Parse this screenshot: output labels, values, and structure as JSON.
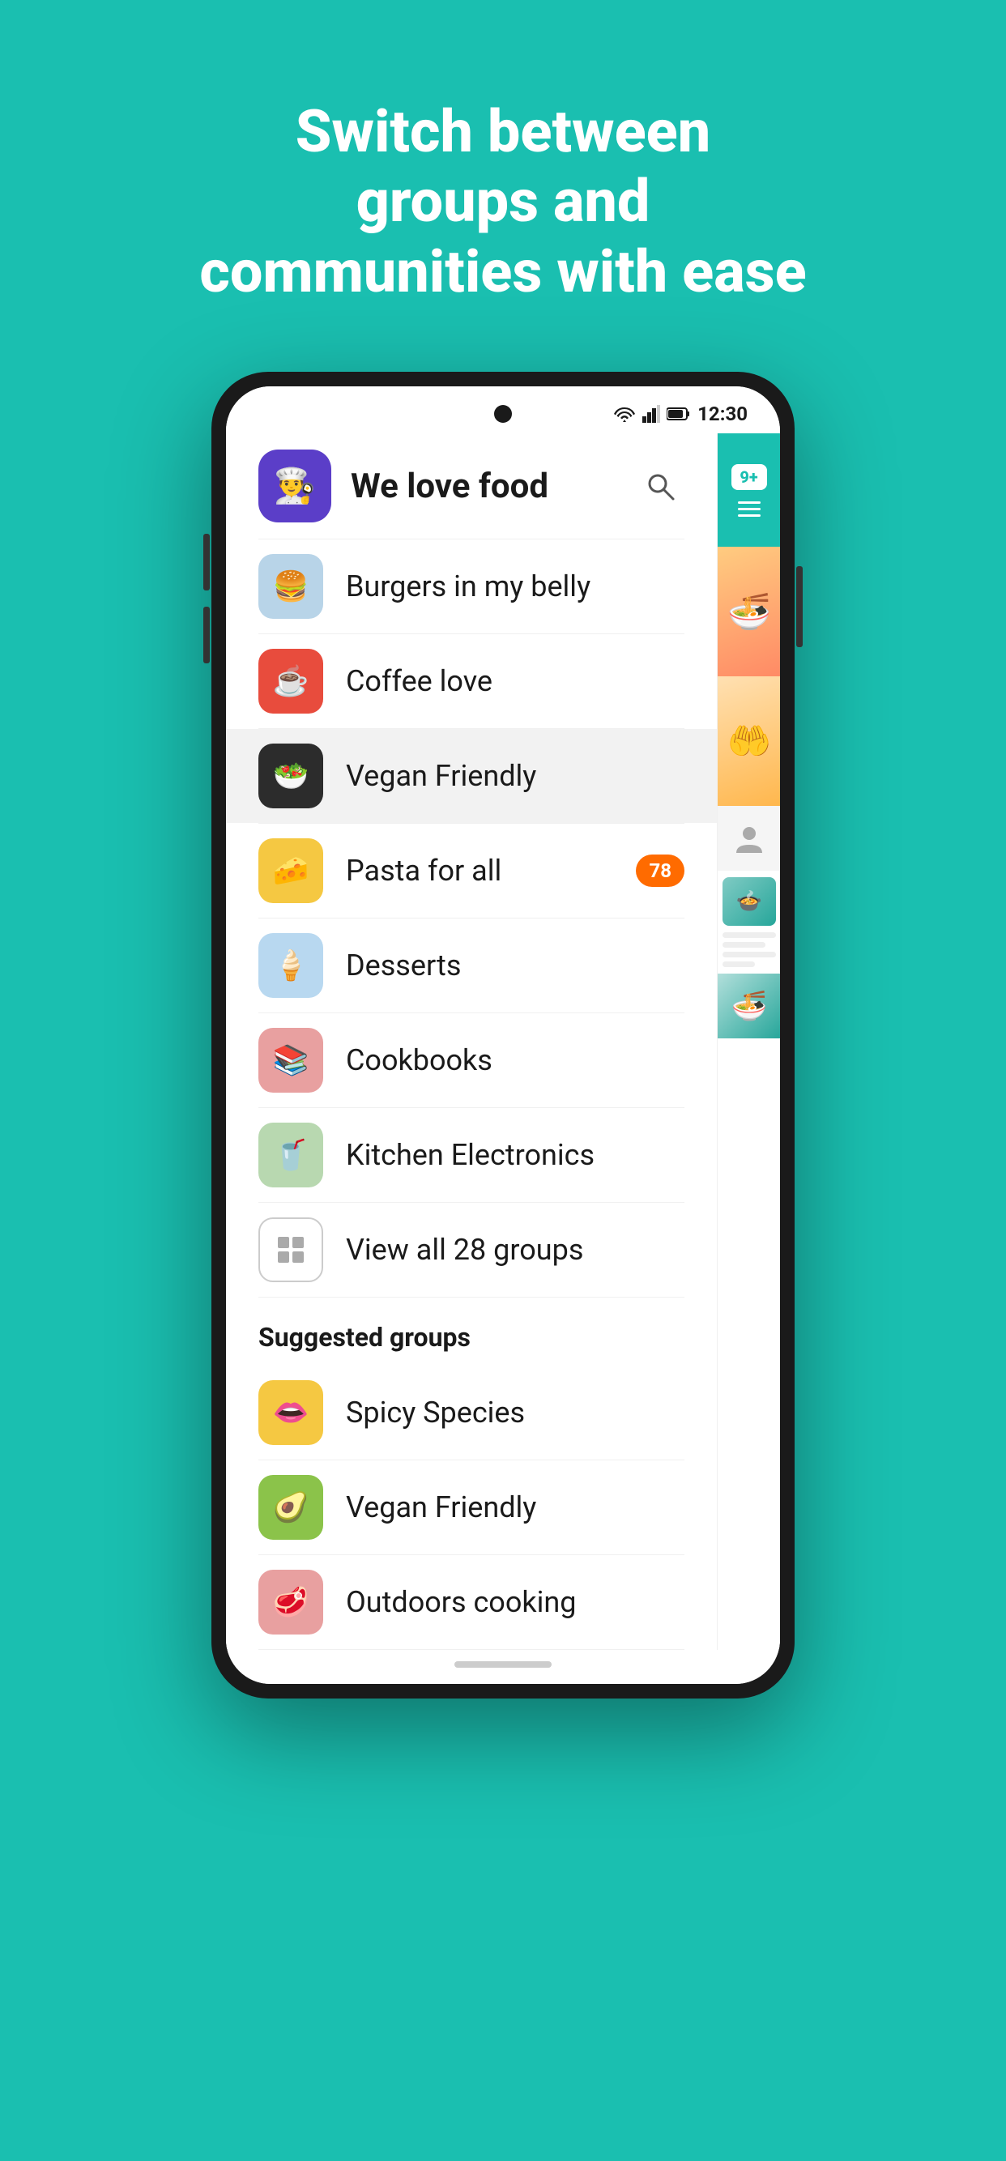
{
  "hero": {
    "line1": "Switch between",
    "line2": "groups and",
    "line3": "communities with ease"
  },
  "statusBar": {
    "time": "12:30"
  },
  "header": {
    "avatarEmoji": "👨‍🍳",
    "title": "We love food"
  },
  "groups": [
    {
      "id": "burgers",
      "label": "Burgers in my belly",
      "emoji": "🍔",
      "colorClass": "burger",
      "badge": null,
      "active": false
    },
    {
      "id": "coffee",
      "label": "Coffee love",
      "emoji": "☕",
      "colorClass": "coffee",
      "badge": null,
      "active": false
    },
    {
      "id": "vegan",
      "label": "Vegan Friendly",
      "emoji": "🥗",
      "colorClass": "vegan",
      "badge": null,
      "active": true
    },
    {
      "id": "pasta",
      "label": "Pasta for all",
      "emoji": "🧀",
      "colorClass": "pasta",
      "badge": "78",
      "active": false
    },
    {
      "id": "desserts",
      "label": "Desserts",
      "emoji": "🍦",
      "colorClass": "desserts",
      "badge": null,
      "active": false
    },
    {
      "id": "cookbooks",
      "label": "Cookbooks",
      "emoji": "📚",
      "colorClass": "cookbooks",
      "badge": null,
      "active": false
    },
    {
      "id": "kitchen",
      "label": "Kitchen Electronics",
      "emoji": "🥤",
      "colorClass": "kitchen",
      "badge": null,
      "active": false
    }
  ],
  "viewAll": {
    "label": "View all 28 groups"
  },
  "suggested": {
    "header": "Suggested groups",
    "items": [
      {
        "id": "spicy",
        "label": "Spicy Species",
        "emoji": "👄",
        "colorClass": "spicy"
      },
      {
        "id": "vegan2",
        "label": "Vegan Friendly",
        "emoji": "🥑",
        "colorClass": "vegan2"
      },
      {
        "id": "outdoors",
        "label": "Outdoors cooking",
        "emoji": "🥩",
        "colorClass": "outdoors"
      }
    ]
  },
  "panel": {
    "badgeCount": "9+"
  }
}
